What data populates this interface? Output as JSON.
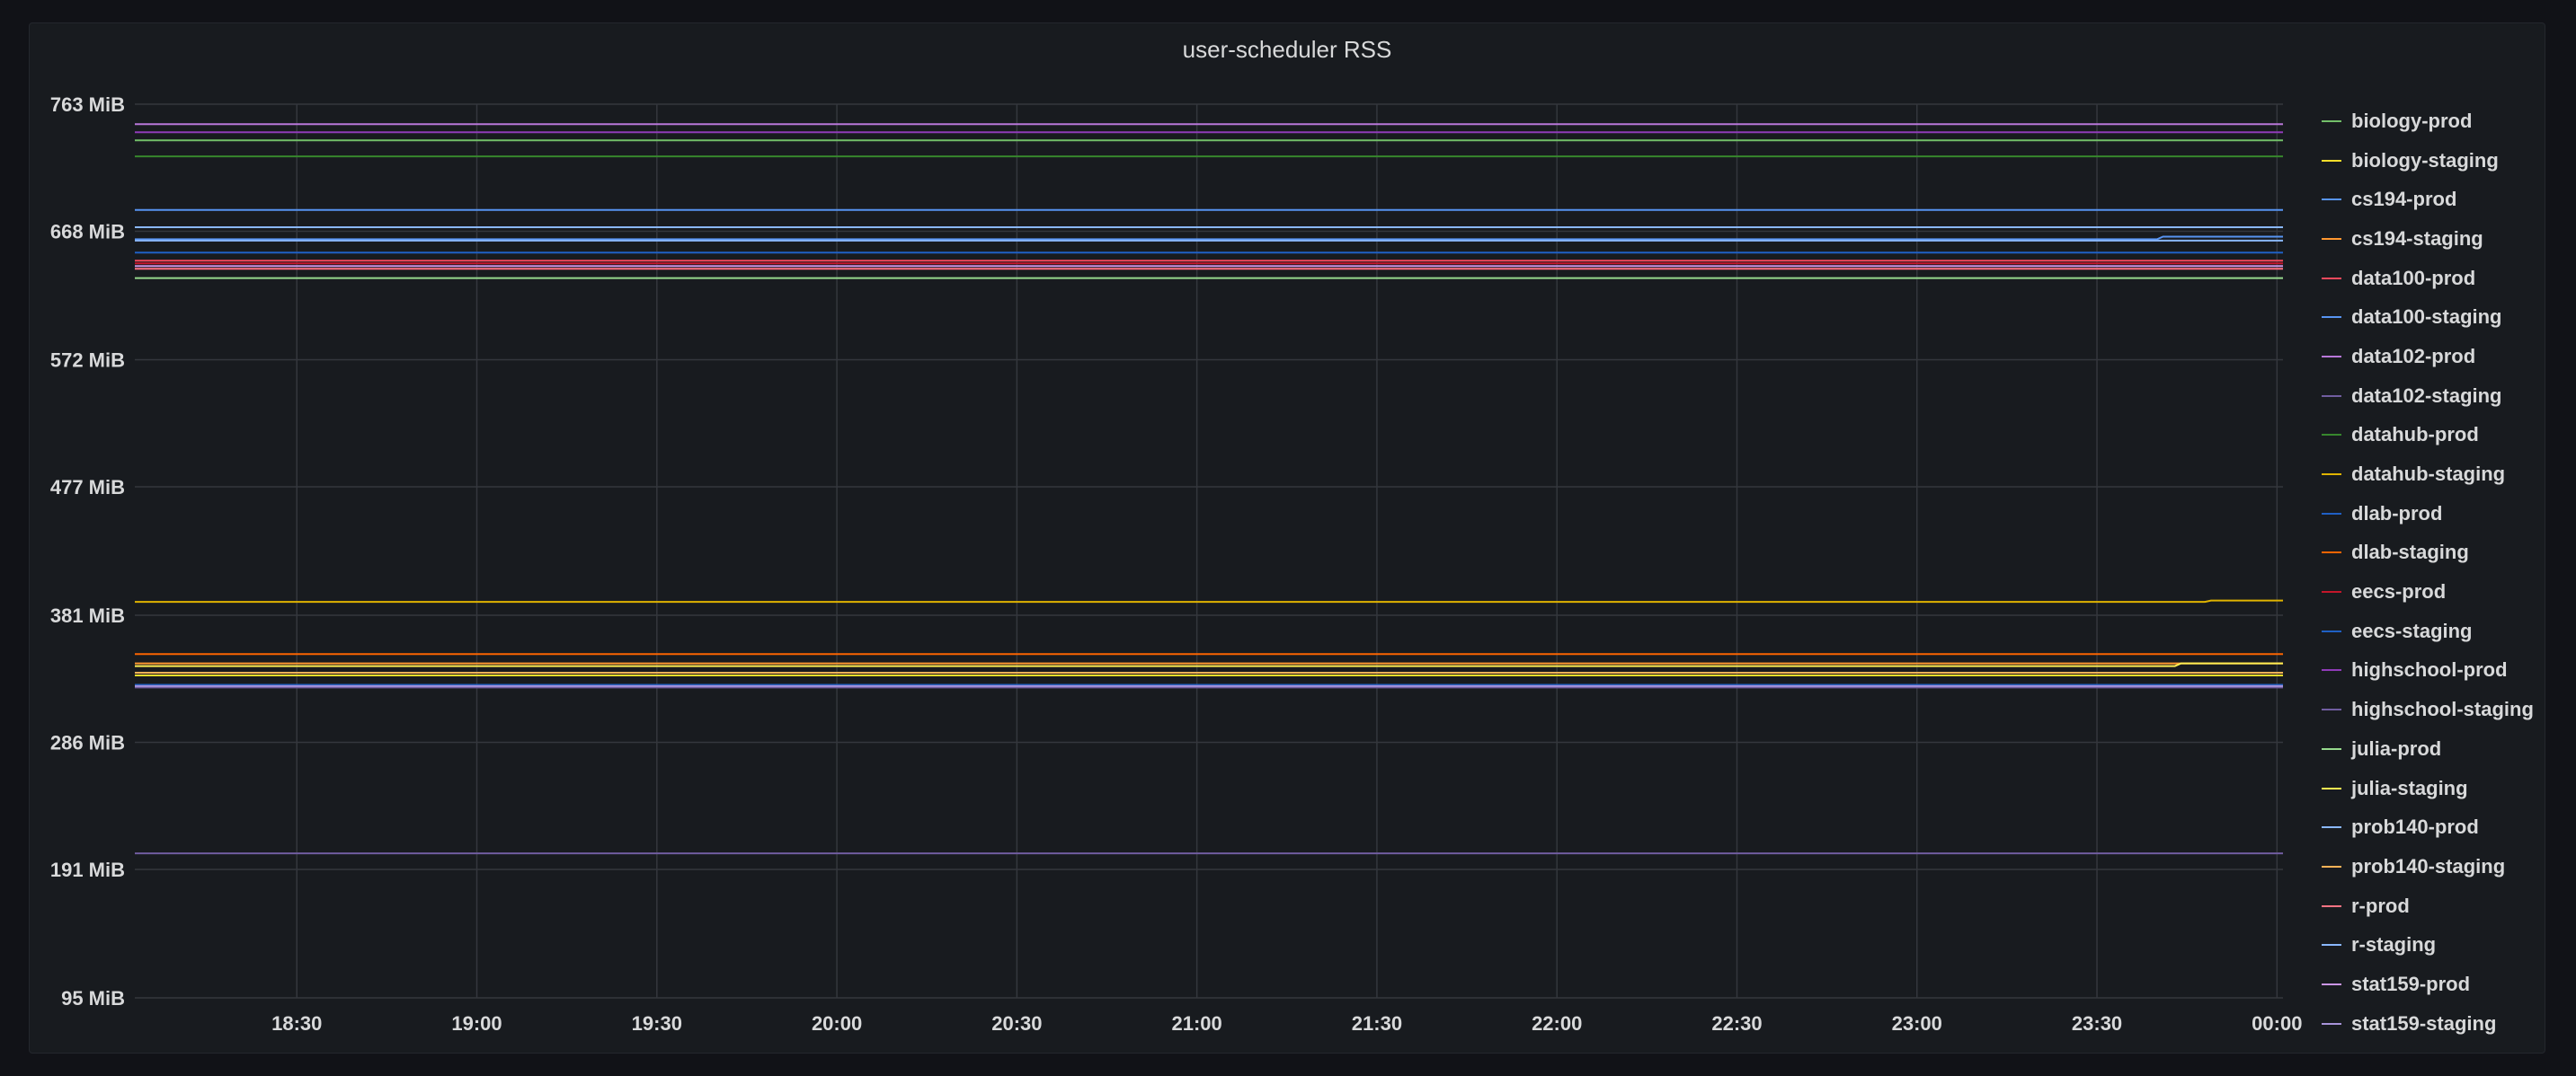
{
  "panel": {
    "title": "user-scheduler RSS"
  },
  "chart_data": {
    "type": "line",
    "title": "user-scheduler RSS",
    "xlabel": "",
    "ylabel": "",
    "y_unit": "MiB",
    "y_ticks": [
      "95 MiB",
      "191 MiB",
      "286 MiB",
      "381 MiB",
      "477 MiB",
      "572 MiB",
      "668 MiB",
      "763 MiB"
    ],
    "y_tick_values": [
      95,
      191,
      286,
      381,
      477,
      572,
      668,
      763
    ],
    "ylim": [
      95,
      763
    ],
    "x_ticks": [
      "18:30",
      "19:00",
      "19:30",
      "20:00",
      "20:30",
      "21:00",
      "21:30",
      "22:00",
      "22:30",
      "23:00",
      "23:30",
      "00:00"
    ],
    "x_tick_values": [
      "18:30",
      "19:00",
      "19:30",
      "20:00",
      "20:30",
      "21:00",
      "21:30",
      "22:00",
      "22:30",
      "23:00",
      "23:30",
      "00:00"
    ],
    "xlim": [
      "18:03",
      "00:01"
    ],
    "grid": true,
    "legend_position": "right",
    "series": [
      {
        "name": "biology-prod",
        "color": "#73bf69",
        "x": [
          "18:03",
          "00:01"
        ],
        "values": [
          736,
          736
        ]
      },
      {
        "name": "biology-staging",
        "color": "#fade2a",
        "x": [
          "18:03",
          "00:01"
        ],
        "values": [
          336,
          336
        ]
      },
      {
        "name": "cs194-prod",
        "color": "#5794f2",
        "x": [
          "18:03",
          "23:40",
          "23:41",
          "00:01"
        ],
        "values": [
          662,
          662,
          664,
          664
        ]
      },
      {
        "name": "cs194-staging",
        "color": "#ff9830",
        "x": [
          "18:03",
          "00:01"
        ],
        "values": [
          345,
          345
        ]
      },
      {
        "name": "data100-prod",
        "color": "#f2495c",
        "x": [
          "18:03",
          "00:01"
        ],
        "values": [
          646,
          646
        ]
      },
      {
        "name": "data100-staging",
        "color": "#5794f2",
        "x": [
          "18:03",
          "00:01"
        ],
        "values": [
          684,
          684
        ]
      },
      {
        "name": "data102-prod",
        "color": "#b877d9",
        "x": [
          "18:03",
          "00:01"
        ],
        "values": [
          748,
          748
        ]
      },
      {
        "name": "data102-staging",
        "color": "#705da0",
        "x": [
          "18:03",
          "00:01"
        ],
        "values": [
          327,
          327
        ]
      },
      {
        "name": "datahub-prod",
        "color": "#37872d",
        "x": [
          "18:03",
          "00:01"
        ],
        "values": [
          724,
          724
        ]
      },
      {
        "name": "datahub-staging",
        "color": "#e0b400",
        "x": [
          "18:03",
          "23:48",
          "23:49",
          "00:01"
        ],
        "values": [
          391,
          391,
          392,
          392
        ]
      },
      {
        "name": "dlab-prod",
        "color": "#1f60c4",
        "x": [
          "18:03",
          "00:01"
        ],
        "values": [
          652,
          652
        ]
      },
      {
        "name": "dlab-staging",
        "color": "#fa6400",
        "x": [
          "18:03",
          "00:01"
        ],
        "values": [
          352,
          352
        ]
      },
      {
        "name": "eecs-prod",
        "color": "#c4162a",
        "x": [
          "18:03",
          "00:01"
        ],
        "values": [
          644,
          644
        ]
      },
      {
        "name": "eecs-staging",
        "color": "#1f60c4",
        "x": [
          "18:03",
          "00:01"
        ],
        "values": [
          329,
          329
        ]
      },
      {
        "name": "highschool-prod",
        "color": "#8f3bb8",
        "x": [
          "18:03",
          "00:01"
        ],
        "values": [
          742,
          742
        ]
      },
      {
        "name": "highschool-staging",
        "color": "#705da0",
        "x": [
          "18:03",
          "00:01"
        ],
        "values": [
          203,
          203
        ]
      },
      {
        "name": "julia-prod",
        "color": "#96d98d",
        "x": [
          "18:03",
          "00:01"
        ],
        "values": [
          633,
          633
        ]
      },
      {
        "name": "julia-staging",
        "color": "#ffee52",
        "x": [
          "18:03",
          "23:43",
          "23:44",
          "00:01"
        ],
        "values": [
          343,
          343,
          345,
          345
        ]
      },
      {
        "name": "prob140-prod",
        "color": "#8ab8ff",
        "x": [
          "18:03",
          "00:01"
        ],
        "values": [
          671,
          671
        ]
      },
      {
        "name": "prob140-staging",
        "color": "#ffb357",
        "x": [
          "18:03",
          "00:01"
        ],
        "values": [
          338,
          338
        ]
      },
      {
        "name": "r-prod",
        "color": "#ff7383",
        "x": [
          "18:03",
          "00:01"
        ],
        "values": [
          640,
          640
        ]
      },
      {
        "name": "r-staging",
        "color": "#8ab8ff",
        "x": [
          "18:03",
          "00:01"
        ],
        "values": [
          661,
          661
        ]
      },
      {
        "name": "stat159-prod",
        "color": "#ca95e5",
        "x": [
          "18:03",
          "00:01"
        ],
        "values": [
          642,
          642
        ]
      },
      {
        "name": "stat159-staging",
        "color": "#a793d9",
        "x": [
          "18:03",
          "00:01"
        ],
        "values": [
          328,
          328
        ]
      }
    ]
  }
}
